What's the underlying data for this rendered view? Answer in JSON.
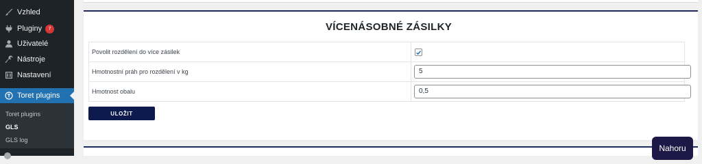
{
  "sidebar": {
    "items": [
      {
        "label": "Vzhled",
        "icon": "brush-icon"
      },
      {
        "label": "Pluginy",
        "icon": "plugin-icon",
        "badge": "7"
      },
      {
        "label": "Uživatelé",
        "icon": "user-icon"
      },
      {
        "label": "Nástroje",
        "icon": "wrench-icon"
      },
      {
        "label": "Nastavení",
        "icon": "settings-icon"
      },
      {
        "label": "Toret plugins",
        "icon": "toret-icon",
        "active": true
      }
    ],
    "submenu": [
      {
        "label": "Toret plugins"
      },
      {
        "label": "GLS",
        "current": true
      },
      {
        "label": "GLS log"
      }
    ]
  },
  "card": {
    "title": "VÍCENÁSOBNÉ ZÁSILKY",
    "rows": [
      {
        "label": "Povolit rozdělení do více zásilek",
        "type": "checkbox",
        "checked": true
      },
      {
        "label": "Hmotnostní práh pro rozdělení v kg",
        "type": "text",
        "value": "5"
      },
      {
        "label": "Hmotnost obalu",
        "type": "text",
        "value": "0,5"
      }
    ],
    "save_label": "ULOŽIT"
  },
  "back_to_top": "Nahoru",
  "colors": {
    "sidebar_bg": "#1d2327",
    "active_item": "#2271b1",
    "badge": "#d63638",
    "save_button": "#0c1a4e",
    "card_border": "#1e2a5a",
    "top_button": "#1e1847"
  }
}
